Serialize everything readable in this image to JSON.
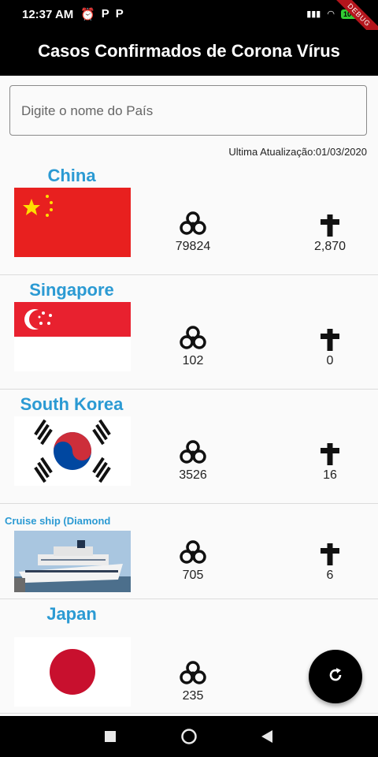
{
  "status_bar": {
    "time": "12:37 AM",
    "battery": "100",
    "icons": [
      "alarm-icon",
      "p-icon",
      "p-icon",
      "signal-icon",
      "wifi-icon",
      "battery-icon"
    ]
  },
  "debug_banner": "DEBUG",
  "app_bar": {
    "title": "Casos Confirmados de Corona Vírus"
  },
  "search": {
    "placeholder": "Digite o nome do País",
    "value": ""
  },
  "last_update": "Ultima Atualização:01/03/2020",
  "countries": [
    {
      "name": "China",
      "cases": "79824",
      "deaths": "2,870",
      "flag": "china"
    },
    {
      "name": "Singapore",
      "cases": "102",
      "deaths": "0",
      "flag": "singapore"
    },
    {
      "name": "South Korea",
      "cases": "3526",
      "deaths": "16",
      "flag": "south-korea"
    },
    {
      "name": "Cruise ship (Diamond",
      "cases": "705",
      "deaths": "6",
      "flag": "cruise-ship"
    },
    {
      "name": "Japan",
      "cases": "235",
      "deaths": "",
      "flag": "japan"
    }
  ],
  "colors": {
    "accent": "#2b9ad3",
    "app_bar": "#000000",
    "background": "#fafafa"
  }
}
